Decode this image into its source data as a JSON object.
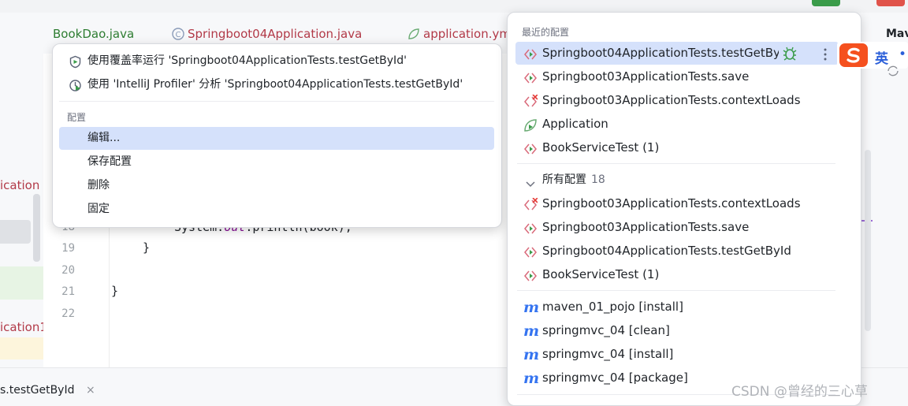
{
  "tabs": [
    {
      "label": "BookDao.java",
      "color": "#2e7d32"
    },
    {
      "label": "Springboot04Application.java",
      "color": "#b23a48"
    },
    {
      "label": "application.ym",
      "color": "#b23a48"
    }
  ],
  "right_tool_label": "Mav",
  "left_fragments": {
    "a": "ication",
    "b": "ication1"
  },
  "gutter_lines": [
    "18",
    "19",
    "20",
    "21",
    "22"
  ],
  "code_lines": {
    "l18_pre": "System.",
    "l18_field": "out",
    "l18_post": ".println(book);",
    "l19": "}",
    "l21": "}"
  },
  "bottom_tab": {
    "label": "s.testGetById",
    "close": "×"
  },
  "context_menu": {
    "items": [
      {
        "label": "使用覆盖率运行 'Springboot04ApplicationTests.testGetById'",
        "icon": "coverage-icon"
      },
      {
        "label": "使用 'IntelliJ Profiler' 分析  'Springboot04ApplicationTests.testGetById'",
        "icon": "profiler-icon"
      }
    ],
    "group_label": "配置",
    "config_items": [
      "编辑...",
      "保存配置",
      "删除",
      "固定"
    ]
  },
  "run_configs": {
    "recent_label": "最近的配置",
    "recent": [
      {
        "label": "Springboot04ApplicationTests.testGetBy",
        "icon": "junit-icon"
      },
      {
        "label": "Springboot03ApplicationTests.save",
        "icon": "junit-icon"
      },
      {
        "label": "Springboot03ApplicationTests.contextLoads",
        "icon": "junit-error-icon"
      },
      {
        "label": "Application",
        "icon": "spring-boot-icon"
      },
      {
        "label": "BookServiceTest (1)",
        "icon": "junit-icon"
      }
    ],
    "all_label": "所有配置",
    "all_count": "18",
    "all": [
      {
        "label": "Springboot03ApplicationTests.contextLoads",
        "icon": "junit-error-icon"
      },
      {
        "label": "Springboot03ApplicationTests.save",
        "icon": "junit-icon"
      },
      {
        "label": "Springboot04ApplicationTests.testGetById",
        "icon": "junit-icon"
      },
      {
        "label": "BookServiceTest (1)",
        "icon": "junit-icon"
      }
    ],
    "maven": [
      {
        "label": "maven_01_pojo [install]"
      },
      {
        "label": "springmvc_04 [clean]"
      },
      {
        "label": "springmvc_04 [install]"
      },
      {
        "label": "springmvc_04 [package]"
      }
    ],
    "maven_glyph": "m"
  },
  "ime": {
    "label": "英",
    "dot": "•"
  },
  "watermark": "CSDN @曾经的三心草",
  "colors": {
    "accent": "#3574f0",
    "selection": "#d5e1fb",
    "error": "#e53935",
    "junit": "#d96a7a"
  }
}
